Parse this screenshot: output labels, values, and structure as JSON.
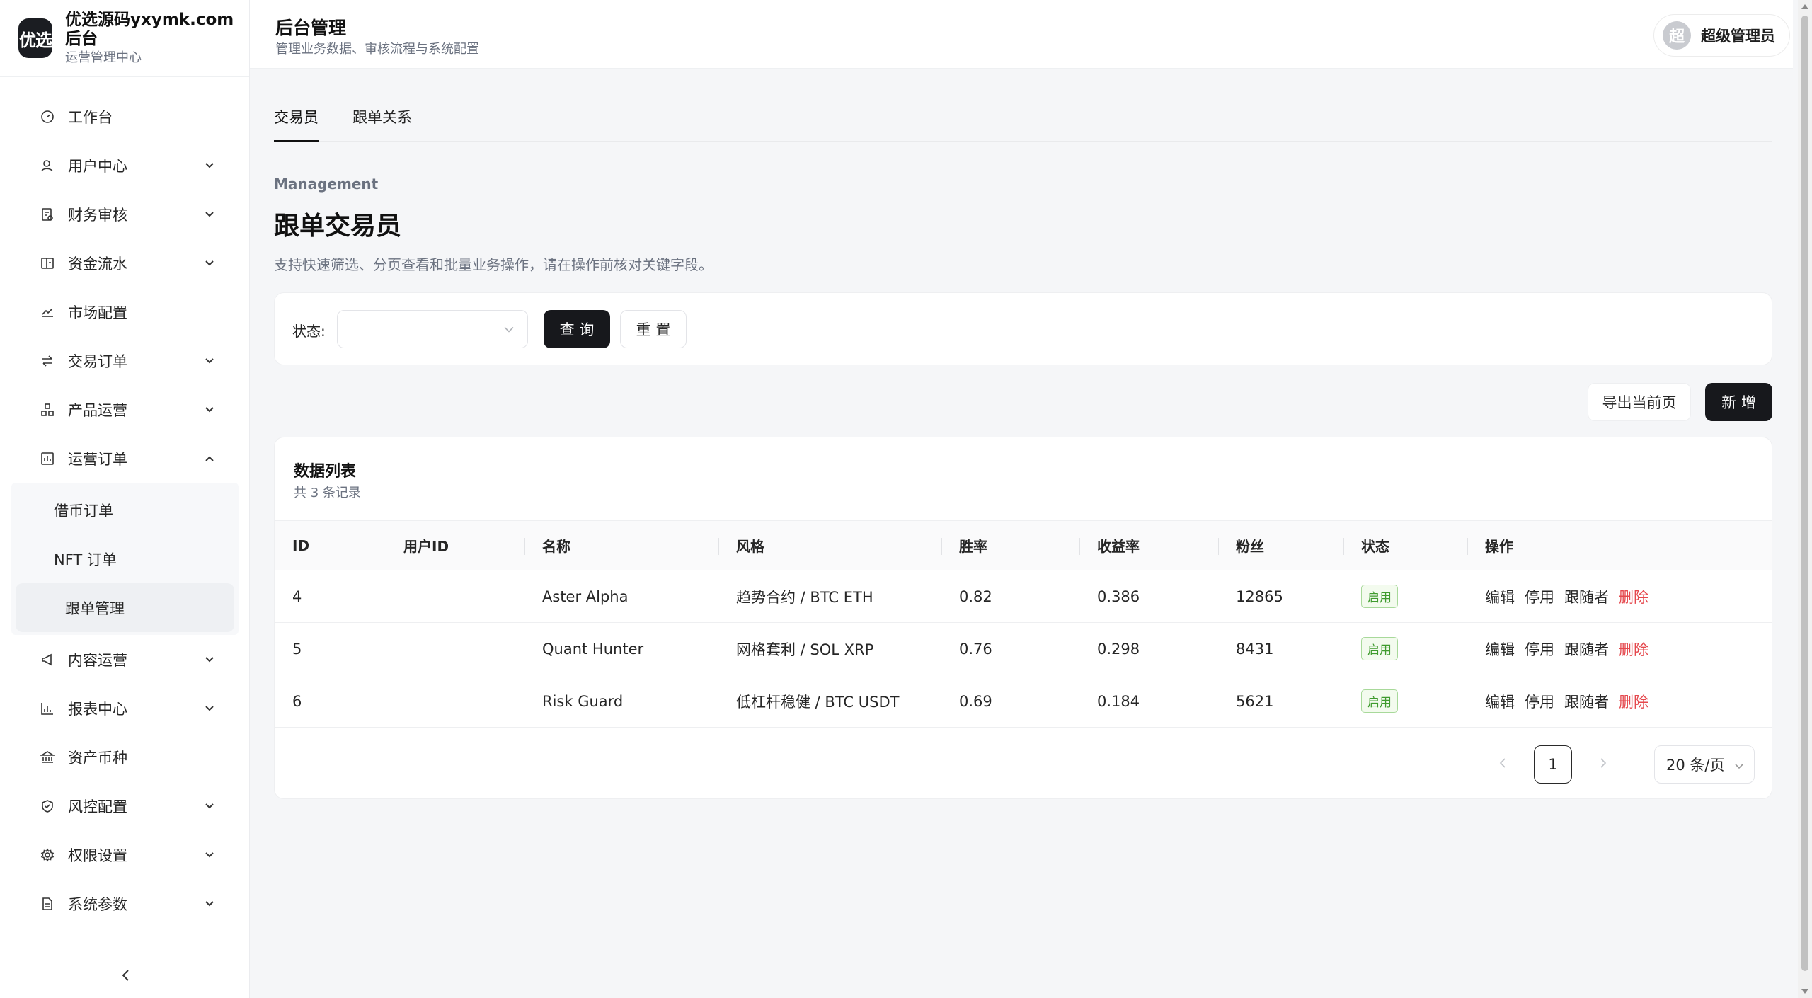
{
  "brand": {
    "logo_text": "优选",
    "name": "优选源码yxymk.com后台",
    "subtitle": "运营管理中心"
  },
  "header": {
    "title": "后台管理",
    "subtitle": "管理业务数据、审核流程与系统配置",
    "user": {
      "avatar_text": "超",
      "name": "超级管理员"
    }
  },
  "sidebar": {
    "items": [
      {
        "label": "工作台",
        "icon": "dashboard-icon",
        "expandable": false
      },
      {
        "label": "用户中心",
        "icon": "user-icon",
        "expandable": true
      },
      {
        "label": "财务审核",
        "icon": "finance-icon",
        "expandable": true
      },
      {
        "label": "资金流水",
        "icon": "ledger-icon",
        "expandable": true
      },
      {
        "label": "市场配置",
        "icon": "chart-line-icon",
        "expandable": false
      },
      {
        "label": "交易订单",
        "icon": "swap-icon",
        "expandable": true
      },
      {
        "label": "产品运营",
        "icon": "product-icon",
        "expandable": true
      },
      {
        "label": "运营订单",
        "icon": "operation-icon",
        "expandable": true,
        "expanded": true
      },
      {
        "label": "内容运营",
        "icon": "megaphone-icon",
        "expandable": true
      },
      {
        "label": "报表中心",
        "icon": "bar-chart-icon",
        "expandable": true
      },
      {
        "label": "资产币种",
        "icon": "bank-icon",
        "expandable": false
      },
      {
        "label": "风控配置",
        "icon": "shield-icon",
        "expandable": true
      },
      {
        "label": "权限设置",
        "icon": "gear-icon",
        "expandable": true
      },
      {
        "label": "系统参数",
        "icon": "document-icon",
        "expandable": true
      }
    ],
    "sub_items": [
      "借币订单",
      "NFT 订单",
      "跟单管理"
    ]
  },
  "tabs": [
    "交易员",
    "跟单关系"
  ],
  "page": {
    "eyebrow": "Management",
    "title": "跟单交易员",
    "description": "支持快速筛选、分页查看和批量业务操作，请在操作前核对关键字段。"
  },
  "filter": {
    "status_label": "状态:",
    "query_label": "查 询",
    "reset_label": "重 置"
  },
  "toolbar": {
    "export_label": "导出当前页",
    "add_label": "新 增"
  },
  "table": {
    "title": "数据列表",
    "count": "共 3 条记录",
    "columns": [
      "ID",
      "用户ID",
      "名称",
      "风格",
      "胜率",
      "收益率",
      "粉丝",
      "状态",
      "操作"
    ],
    "rows": [
      {
        "id": "4",
        "user_id": "",
        "name": "Aster Alpha",
        "style": "趋势合约 / BTC ETH",
        "win_rate": "0.82",
        "return_rate": "0.386",
        "fans": "12865",
        "status": "启用"
      },
      {
        "id": "5",
        "user_id": "",
        "name": "Quant Hunter",
        "style": "网格套利 / SOL XRP",
        "win_rate": "0.76",
        "return_rate": "0.298",
        "fans": "8431",
        "status": "启用"
      },
      {
        "id": "6",
        "user_id": "",
        "name": "Risk Guard",
        "style": "低杠杆稳健 / BTC USDT",
        "win_rate": "0.69",
        "return_rate": "0.184",
        "fans": "5621",
        "status": "启用"
      }
    ],
    "actions": [
      "编辑",
      "停用",
      "跟随者",
      "删除"
    ]
  },
  "pagination": {
    "current": "1",
    "page_size": "20 条/页"
  },
  "colors": {
    "primary_dark": "#17181c",
    "success": "#3f9b2e",
    "danger": "#e5484d"
  }
}
